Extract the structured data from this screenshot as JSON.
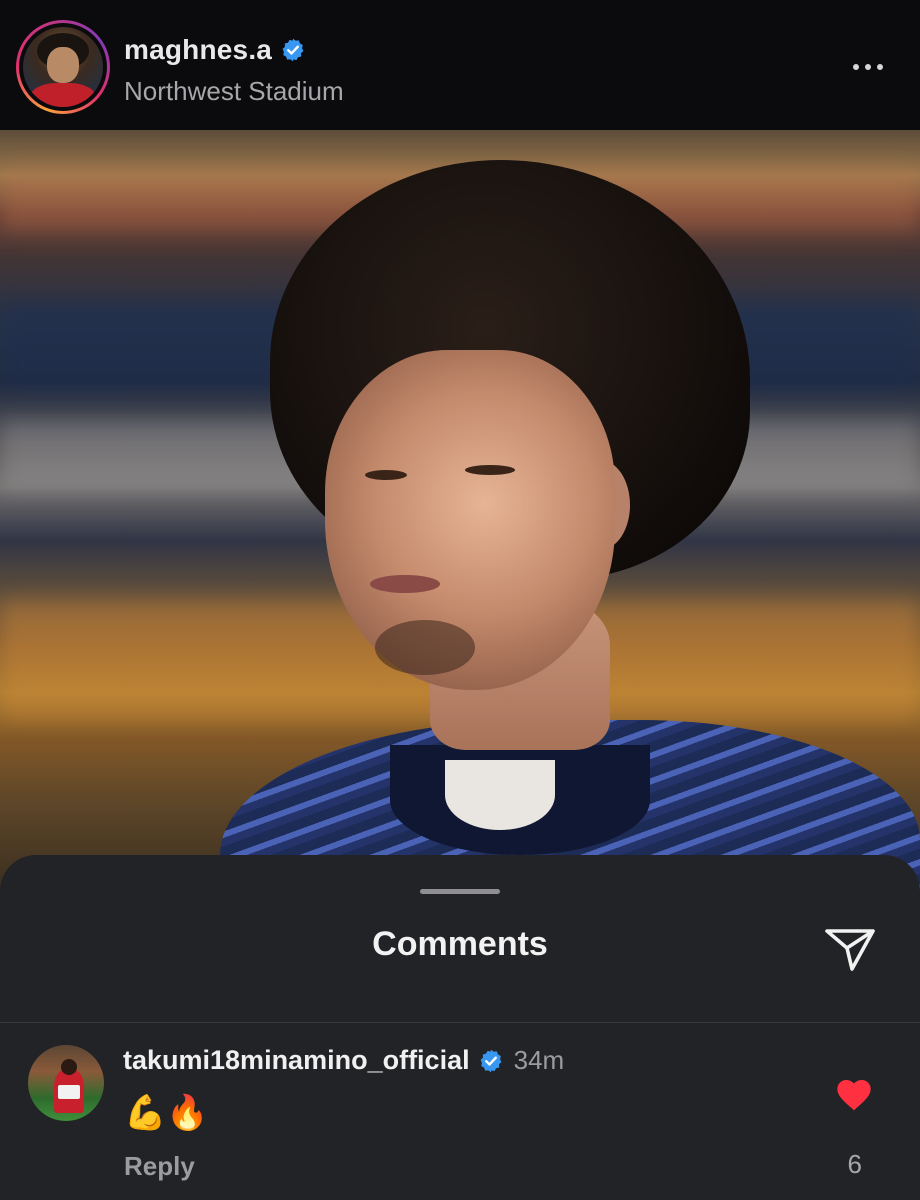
{
  "post": {
    "username": "maghnes.a",
    "location": "Northwest Stadium",
    "verified": true
  },
  "comments_sheet": {
    "title": "Comments",
    "comments": [
      {
        "username": "takumi18minamino_official",
        "verified": true,
        "time": "34m",
        "text": "💪🔥",
        "reply_label": "Reply",
        "like_count": "6",
        "liked": true
      }
    ]
  },
  "icons": {
    "verified": "verified-badge-icon",
    "more": "more-options-icon",
    "share": "share-send-icon",
    "like": "heart-icon"
  },
  "colors": {
    "verified_blue": "#3897f0",
    "like_red": "#ff3040",
    "sheet_background": "#222327",
    "header_background": "#0b0b0d"
  }
}
